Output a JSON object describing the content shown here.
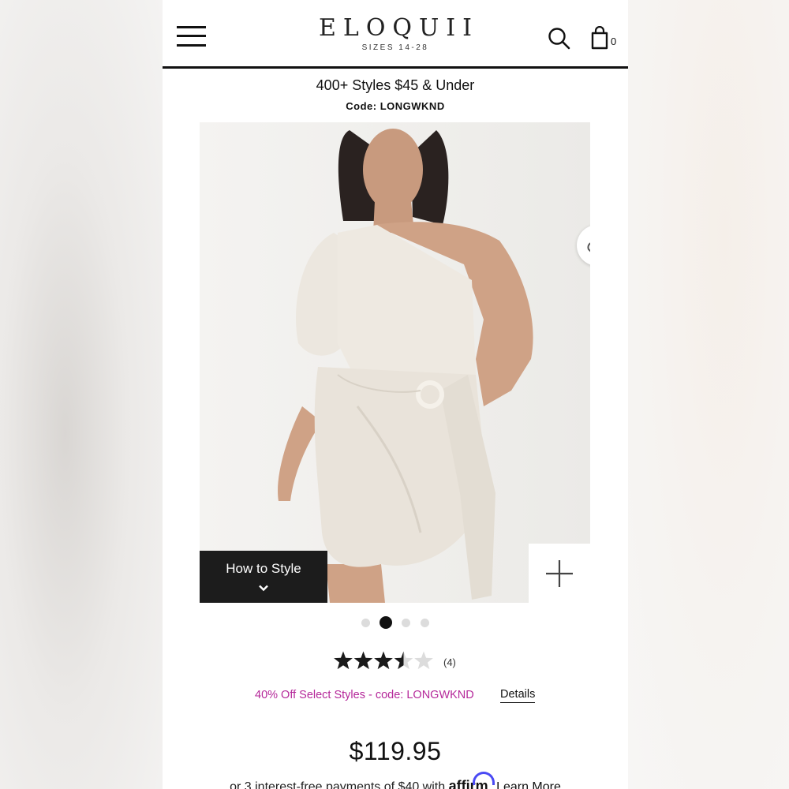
{
  "header": {
    "brand": "ELOQUII",
    "sizes": "SIZES 14-28",
    "cart_count": "0"
  },
  "promo": {
    "title": "400+ Styles $45 & Under",
    "code": "Code: LONGWKND"
  },
  "product": {
    "how_to_style": "How to Style",
    "carousel": {
      "total": 4,
      "active_index": 1
    },
    "rating": {
      "value": 3.5,
      "max": 5,
      "count_label": "(4)"
    },
    "offer": "40% Off Select Styles - code: LONGWKND",
    "details_label": "Details",
    "price": "$119.95",
    "installments": {
      "prefix": "or 3 interest-free payments of $40 with",
      "provider": "affirm",
      "learn_more": "Learn More"
    }
  },
  "colors": {
    "offer_pink": "#b5289a",
    "affirm_blue": "#4a4af4"
  },
  "icons": [
    "menu-icon",
    "search-icon",
    "shopping-bag-icon",
    "heart-icon",
    "chevron-down-icon",
    "plus-icon",
    "star-icon"
  ]
}
